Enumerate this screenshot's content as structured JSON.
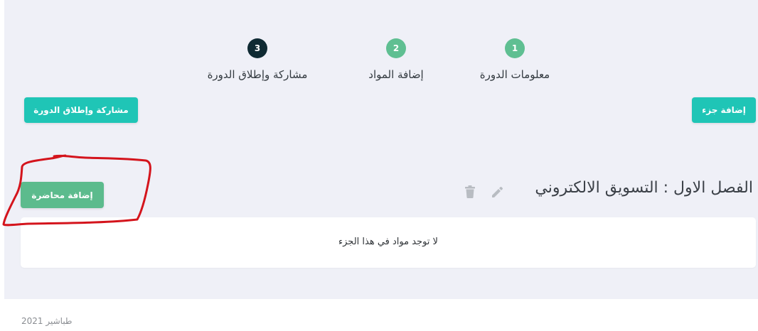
{
  "stepper": {
    "steps": [
      {
        "number": "1",
        "label": "معلومات الدورة",
        "state": "done"
      },
      {
        "number": "2",
        "label": "إضافة المواد",
        "state": "done"
      },
      {
        "number": "3",
        "label": "مشاركة وإطلاق الدورة",
        "state": "active"
      }
    ],
    "colors": {
      "done": "#5fbf92",
      "active": "#0f2a33"
    }
  },
  "toolbar": {
    "share_launch_label": "مشاركة وإطلاق الدورة",
    "add_part_label": "إضافة جزء"
  },
  "section": {
    "title": "الفصل الاول : التسويق الالكتروني",
    "add_lecture_label": "إضافة محاضرة",
    "edit_icon": "pencil-icon",
    "delete_icon": "trash-icon",
    "empty_message": "لا توجد مواد في هذا الجزء"
  },
  "footer": {
    "text": "طباشير 2021"
  },
  "colors": {
    "teal": "#1fc5b6",
    "green": "#5cbb8d",
    "annotation": "#d4141c",
    "panel_bg": "#eff0f7"
  }
}
